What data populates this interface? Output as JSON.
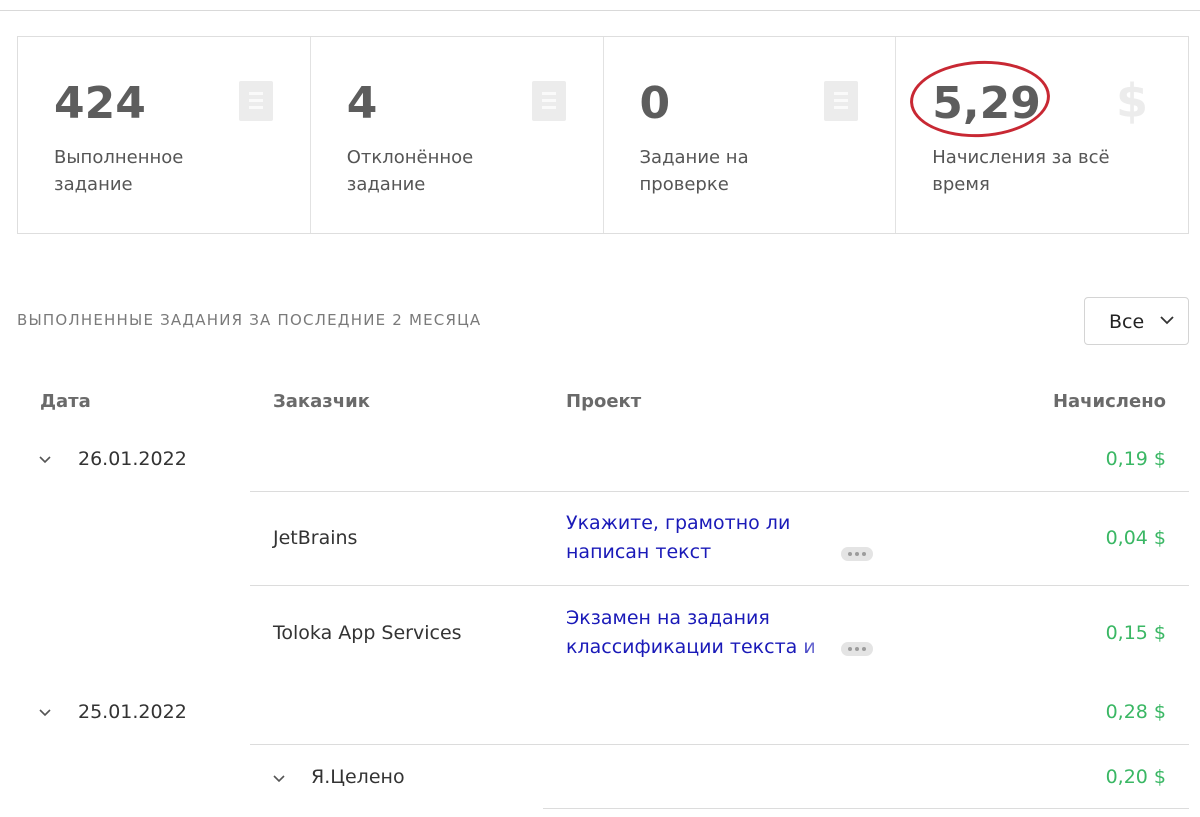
{
  "stats": [
    {
      "value": "424",
      "label": "Выполненное задание",
      "icon": "document-icon"
    },
    {
      "value": "4",
      "label": "Отклонённое задание",
      "icon": "document-icon"
    },
    {
      "value": "0",
      "label": "Задание на проверке",
      "icon": "document-icon"
    },
    {
      "value": "5,29",
      "label": "Начисления за всё время",
      "icon": "dollar-icon"
    }
  ],
  "highlight_color": "#c82833",
  "section": {
    "title": "ВЫПОЛНЕННЫЕ ЗАДАНИЯ ЗА ПОСЛЕДНИЕ 2 МЕСЯЦА",
    "filter": {
      "selected": "Все"
    }
  },
  "table": {
    "headers": {
      "date": "Дата",
      "customer": "Заказчик",
      "project": "Проект",
      "earned": "Начислено"
    },
    "groups": [
      {
        "date": "26.01.2022",
        "total": "0,19 $",
        "rows": [
          {
            "customer": "JetBrains",
            "project": "Укажите, грамотно ли написан текст",
            "amount": "0,04 $"
          },
          {
            "customer": "Toloka App Services",
            "project": "Экзамен на задания классификации текста и ве",
            "amount": "0,15 $"
          }
        ]
      },
      {
        "date": "25.01.2022",
        "total": "0,28 $",
        "subgroups": [
          {
            "customer": "Я.Целено",
            "amount": "0,20 $"
          }
        ]
      }
    ]
  },
  "colors": {
    "amount_green": "#3ab764",
    "link_blue": "#1a1ab8"
  }
}
